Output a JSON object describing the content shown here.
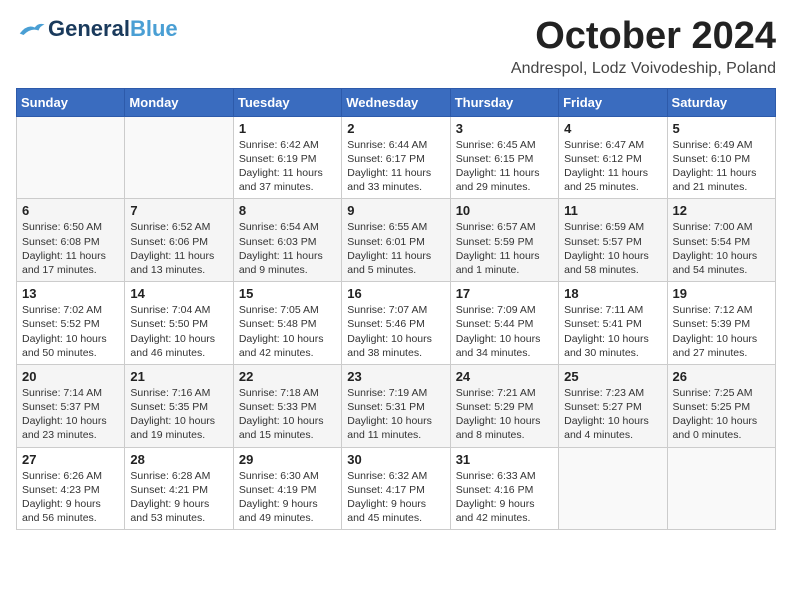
{
  "header": {
    "logo_general": "General",
    "logo_blue": "Blue",
    "month_title": "October 2024",
    "location": "Andrespol, Lodz Voivodeship, Poland"
  },
  "days_of_week": [
    "Sunday",
    "Monday",
    "Tuesday",
    "Wednesday",
    "Thursday",
    "Friday",
    "Saturday"
  ],
  "weeks": [
    [
      {
        "day": "",
        "content": ""
      },
      {
        "day": "",
        "content": ""
      },
      {
        "day": "1",
        "content": "Sunrise: 6:42 AM\nSunset: 6:19 PM\nDaylight: 11 hours and 37 minutes."
      },
      {
        "day": "2",
        "content": "Sunrise: 6:44 AM\nSunset: 6:17 PM\nDaylight: 11 hours and 33 minutes."
      },
      {
        "day": "3",
        "content": "Sunrise: 6:45 AM\nSunset: 6:15 PM\nDaylight: 11 hours and 29 minutes."
      },
      {
        "day": "4",
        "content": "Sunrise: 6:47 AM\nSunset: 6:12 PM\nDaylight: 11 hours and 25 minutes."
      },
      {
        "day": "5",
        "content": "Sunrise: 6:49 AM\nSunset: 6:10 PM\nDaylight: 11 hours and 21 minutes."
      }
    ],
    [
      {
        "day": "6",
        "content": "Sunrise: 6:50 AM\nSunset: 6:08 PM\nDaylight: 11 hours and 17 minutes."
      },
      {
        "day": "7",
        "content": "Sunrise: 6:52 AM\nSunset: 6:06 PM\nDaylight: 11 hours and 13 minutes."
      },
      {
        "day": "8",
        "content": "Sunrise: 6:54 AM\nSunset: 6:03 PM\nDaylight: 11 hours and 9 minutes."
      },
      {
        "day": "9",
        "content": "Sunrise: 6:55 AM\nSunset: 6:01 PM\nDaylight: 11 hours and 5 minutes."
      },
      {
        "day": "10",
        "content": "Sunrise: 6:57 AM\nSunset: 5:59 PM\nDaylight: 11 hours and 1 minute."
      },
      {
        "day": "11",
        "content": "Sunrise: 6:59 AM\nSunset: 5:57 PM\nDaylight: 10 hours and 58 minutes."
      },
      {
        "day": "12",
        "content": "Sunrise: 7:00 AM\nSunset: 5:54 PM\nDaylight: 10 hours and 54 minutes."
      }
    ],
    [
      {
        "day": "13",
        "content": "Sunrise: 7:02 AM\nSunset: 5:52 PM\nDaylight: 10 hours and 50 minutes."
      },
      {
        "day": "14",
        "content": "Sunrise: 7:04 AM\nSunset: 5:50 PM\nDaylight: 10 hours and 46 minutes."
      },
      {
        "day": "15",
        "content": "Sunrise: 7:05 AM\nSunset: 5:48 PM\nDaylight: 10 hours and 42 minutes."
      },
      {
        "day": "16",
        "content": "Sunrise: 7:07 AM\nSunset: 5:46 PM\nDaylight: 10 hours and 38 minutes."
      },
      {
        "day": "17",
        "content": "Sunrise: 7:09 AM\nSunset: 5:44 PM\nDaylight: 10 hours and 34 minutes."
      },
      {
        "day": "18",
        "content": "Sunrise: 7:11 AM\nSunset: 5:41 PM\nDaylight: 10 hours and 30 minutes."
      },
      {
        "day": "19",
        "content": "Sunrise: 7:12 AM\nSunset: 5:39 PM\nDaylight: 10 hours and 27 minutes."
      }
    ],
    [
      {
        "day": "20",
        "content": "Sunrise: 7:14 AM\nSunset: 5:37 PM\nDaylight: 10 hours and 23 minutes."
      },
      {
        "day": "21",
        "content": "Sunrise: 7:16 AM\nSunset: 5:35 PM\nDaylight: 10 hours and 19 minutes."
      },
      {
        "day": "22",
        "content": "Sunrise: 7:18 AM\nSunset: 5:33 PM\nDaylight: 10 hours and 15 minutes."
      },
      {
        "day": "23",
        "content": "Sunrise: 7:19 AM\nSunset: 5:31 PM\nDaylight: 10 hours and 11 minutes."
      },
      {
        "day": "24",
        "content": "Sunrise: 7:21 AM\nSunset: 5:29 PM\nDaylight: 10 hours and 8 minutes."
      },
      {
        "day": "25",
        "content": "Sunrise: 7:23 AM\nSunset: 5:27 PM\nDaylight: 10 hours and 4 minutes."
      },
      {
        "day": "26",
        "content": "Sunrise: 7:25 AM\nSunset: 5:25 PM\nDaylight: 10 hours and 0 minutes."
      }
    ],
    [
      {
        "day": "27",
        "content": "Sunrise: 6:26 AM\nSunset: 4:23 PM\nDaylight: 9 hours and 56 minutes."
      },
      {
        "day": "28",
        "content": "Sunrise: 6:28 AM\nSunset: 4:21 PM\nDaylight: 9 hours and 53 minutes."
      },
      {
        "day": "29",
        "content": "Sunrise: 6:30 AM\nSunset: 4:19 PM\nDaylight: 9 hours and 49 minutes."
      },
      {
        "day": "30",
        "content": "Sunrise: 6:32 AM\nSunset: 4:17 PM\nDaylight: 9 hours and 45 minutes."
      },
      {
        "day": "31",
        "content": "Sunrise: 6:33 AM\nSunset: 4:16 PM\nDaylight: 9 hours and 42 minutes."
      },
      {
        "day": "",
        "content": ""
      },
      {
        "day": "",
        "content": ""
      }
    ]
  ]
}
